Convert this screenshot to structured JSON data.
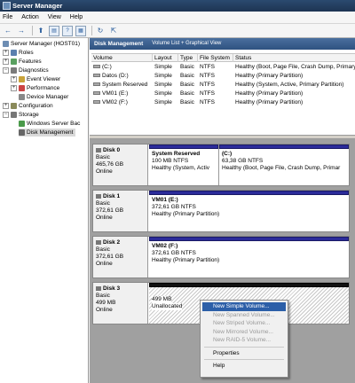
{
  "window": {
    "title": "Server Manager"
  },
  "menubar": {
    "items": [
      "File",
      "Action",
      "View",
      "Help"
    ]
  },
  "toolbar": {
    "back": "←",
    "forward": "→",
    "up": "⬆",
    "show_tree": "▤",
    "help": "?",
    "properties": "▦",
    "refresh": "↻",
    "export": "⇱"
  },
  "tree": {
    "root": "Server Manager (HOST01)",
    "roles": "Roles",
    "features": "Features",
    "diagnostics": "Diagnostics",
    "event_viewer": "Event Viewer",
    "performance": "Performance",
    "device_manager": "Device Manager",
    "configuration": "Configuration",
    "storage": "Storage",
    "windows_server_backup": "Windows Server Bac",
    "disk_management": "Disk Management"
  },
  "panel_header": {
    "title": "Disk Management",
    "subtitle": "Volume List + Graphical View"
  },
  "volume_table": {
    "columns": [
      "Volume",
      "Layout",
      "Type",
      "File System",
      "Status"
    ],
    "rows": [
      {
        "volume": "(C:)",
        "layout": "Simple",
        "type": "Basic",
        "fs": "NTFS",
        "status": "Healthy (Boot, Page File, Crash Dump, Primary"
      },
      {
        "volume": "Datos (D:)",
        "layout": "Simple",
        "type": "Basic",
        "fs": "NTFS",
        "status": "Healthy (Primary Partition)"
      },
      {
        "volume": "System Reserved",
        "layout": "Simple",
        "type": "Basic",
        "fs": "NTFS",
        "status": "Healthy (System, Active, Primary Partition)"
      },
      {
        "volume": "VM01 (E:)",
        "layout": "Simple",
        "type": "Basic",
        "fs": "NTFS",
        "status": "Healthy (Primary Partition)"
      },
      {
        "volume": "VM02 (F:)",
        "layout": "Simple",
        "type": "Basic",
        "fs": "NTFS",
        "status": "Healthy (Primary Partition)"
      }
    ]
  },
  "disks": [
    {
      "name": "Disk 0",
      "type": "Basic",
      "size": "465,76 GB",
      "state": "Online",
      "partitions": [
        {
          "name": "System Reserved",
          "detail": "100 MB NTFS",
          "status": "Healthy (System, Activ"
        },
        {
          "name": "(C:)",
          "detail": "63,38 GB NTFS",
          "status": "Healthy (Boot, Page File, Crash Dump, Primar"
        }
      ]
    },
    {
      "name": "Disk 1",
      "type": "Basic",
      "size": "372,61 GB",
      "state": "Online",
      "partitions": [
        {
          "name": "VM01  (E:)",
          "detail": "372,61 GB NTFS",
          "status": "Healthy (Primary Partition)"
        }
      ]
    },
    {
      "name": "Disk 2",
      "type": "Basic",
      "size": "372,61 GB",
      "state": "Online",
      "partitions": [
        {
          "name": "VM02  (F:)",
          "detail": "372,61 GB NTFS",
          "status": "Healthy (Primary Partition)"
        }
      ]
    },
    {
      "name": "Disk 3",
      "type": "Basic",
      "size": "499 MB",
      "state": "Online",
      "partitions": [
        {
          "name": "499 MB",
          "detail": "Unallocated",
          "status": ""
        }
      ]
    }
  ],
  "context_menu": {
    "items": [
      "New Simple Volume...",
      "New Spanned Volume...",
      "New Striped Volume...",
      "New Mirrored Volume...",
      "New RAID-5 Volume...",
      "Properties",
      "Help"
    ]
  },
  "colors": {
    "partition_bar": "#2b2b9a",
    "unallocated_bar": "#111111",
    "selection": "#2c5fa8"
  }
}
